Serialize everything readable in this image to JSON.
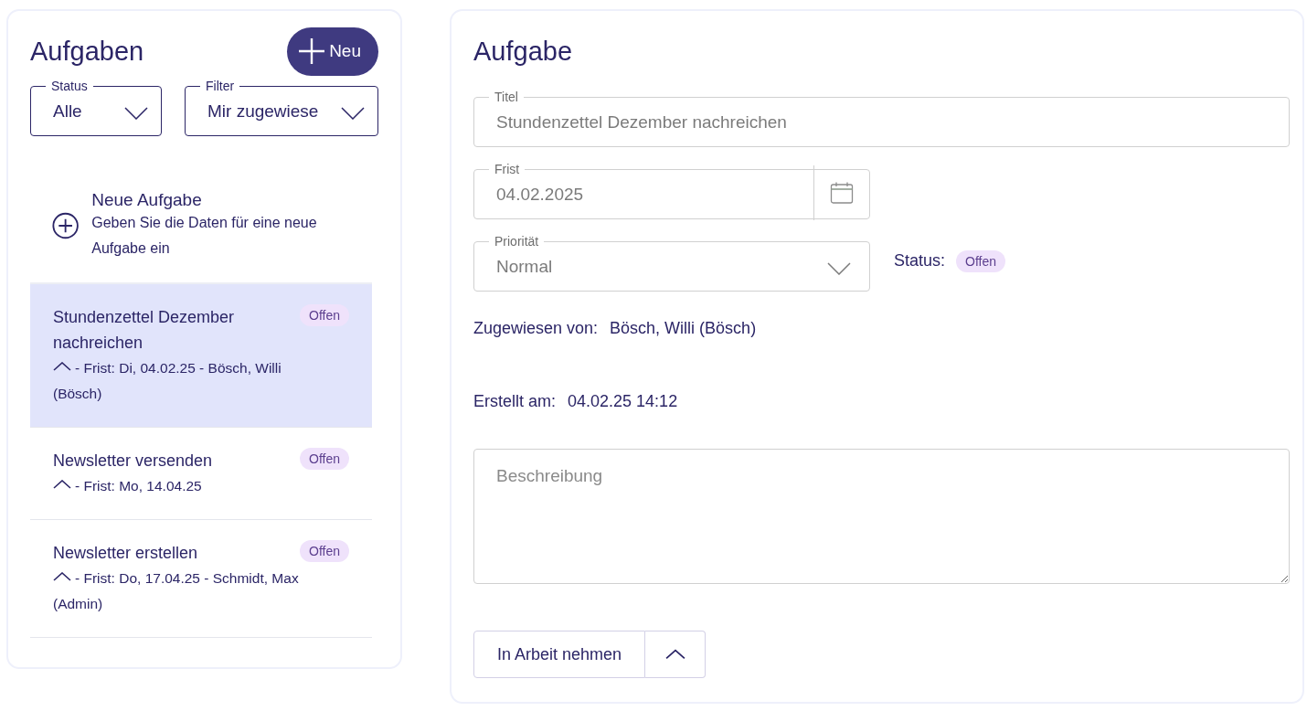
{
  "list_panel": {
    "title": "Aufgaben",
    "new_button": "Neu",
    "filters": [
      {
        "label": "Status",
        "value": "Alle"
      },
      {
        "label": "Filter",
        "value": "Mir zugewiese"
      }
    ],
    "new_task": {
      "title": "Neue Aufgabe",
      "hint": "Geben Sie die Daten für eine neue Aufgabe ein"
    },
    "tasks": [
      {
        "title": "Stundenzettel Dezember nachreichen",
        "meta": "- Frist: Di, 04.02.25 - Bösch, Willi (Bösch)",
        "status": "Offen",
        "selected": true
      },
      {
        "title": "Newsletter versenden",
        "meta": "- Frist: Mo, 14.04.25",
        "status": "Offen",
        "selected": false
      },
      {
        "title": "Newsletter erstellen",
        "meta": "- Frist: Do, 17.04.25 - Schmidt, Max (Admin)",
        "status": "Offen",
        "selected": false
      }
    ]
  },
  "detail": {
    "title": "Aufgabe",
    "fields": [
      {
        "kind": "text",
        "label": "Titel",
        "value": "Stundenzettel Dezember nachreichen"
      },
      {
        "kind": "date",
        "label": "Frist",
        "value": "04.02.2025"
      },
      {
        "kind": "select",
        "label": "Priorität",
        "value": "Normal"
      }
    ],
    "status_label": "Status:",
    "status": "Offen",
    "info": [
      {
        "label": "Zugewiesen von:",
        "value": "Bösch, Willi (Bösch)"
      },
      {
        "label": "Erstellt am:",
        "value": "04.02.25 14:12"
      }
    ],
    "description": {
      "placeholder": "Beschreibung"
    },
    "action_button": "In Arbeit nehmen"
  }
}
